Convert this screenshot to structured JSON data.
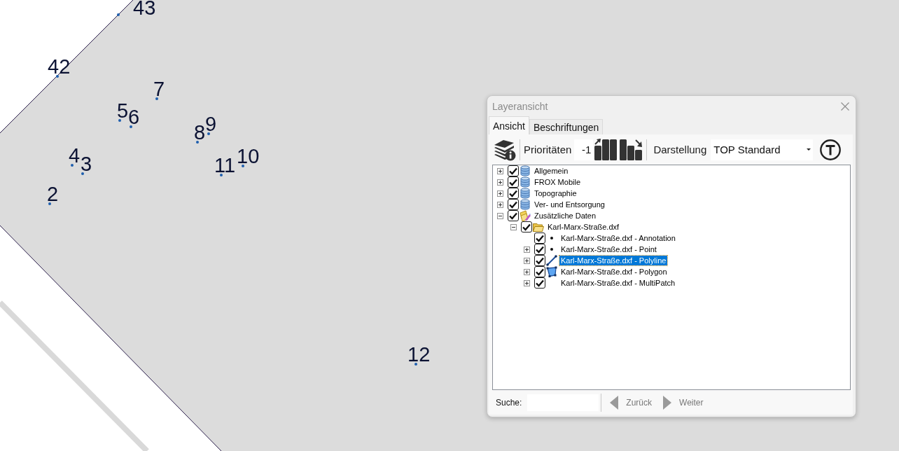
{
  "map": {
    "points": [
      {
        "label": "43"
      },
      {
        "label": "42"
      },
      {
        "label": "7"
      },
      {
        "label": "5"
      },
      {
        "label": "6"
      },
      {
        "label": "9"
      },
      {
        "label": "8"
      },
      {
        "label": "4"
      },
      {
        "label": "10"
      },
      {
        "label": "3"
      },
      {
        "label": "11"
      },
      {
        "label": "2"
      },
      {
        "label": "12"
      }
    ]
  },
  "window": {
    "title": "Layeransicht"
  },
  "tabs": [
    {
      "label": "Ansicht",
      "selected": true
    },
    {
      "label": "Beschriftungen",
      "selected": false
    }
  ],
  "toolbar": {
    "priority_label": "Prioritäten",
    "priority_value": "-1",
    "display_label": "Darstellung",
    "display_value": "TOP Standard"
  },
  "tree": [
    {
      "label": "Allgemein",
      "kind": "database",
      "expandable": true,
      "expanded": false,
      "checked": true,
      "selected": false
    },
    {
      "label": "FROX Mobile",
      "kind": "database",
      "expandable": true,
      "expanded": false,
      "checked": true,
      "selected": false
    },
    {
      "label": "Topographie",
      "kind": "database",
      "expandable": true,
      "expanded": false,
      "checked": true,
      "selected": false
    },
    {
      "label": "Ver- und Entsorgung",
      "kind": "database",
      "expandable": true,
      "expanded": false,
      "checked": true,
      "selected": false
    },
    {
      "label": "Zusätzliche Daten",
      "kind": "custom",
      "expandable": true,
      "expanded": true,
      "checked": true,
      "selected": false,
      "children": [
        {
          "label": "Karl-Marx-Straße.dxf",
          "kind": "folder",
          "expandable": true,
          "expanded": true,
          "checked": true,
          "selected": false,
          "children": [
            {
              "label": "Karl-Marx-Straße.dxf - Annotation",
              "kind": "point",
              "expandable": false,
              "checked": true,
              "selected": false
            },
            {
              "label": "Karl-Marx-Straße.dxf - Point",
              "kind": "point",
              "expandable": true,
              "expanded": false,
              "checked": true,
              "selected": false
            },
            {
              "label": "Karl-Marx-Straße.dxf - Polyline",
              "kind": "line",
              "expandable": true,
              "expanded": false,
              "checked": true,
              "selected": true
            },
            {
              "label": "Karl-Marx-Straße.dxf - Polygon",
              "kind": "polygon",
              "expandable": true,
              "expanded": false,
              "checked": true,
              "selected": false
            },
            {
              "label": "Karl-Marx-Straße.dxf - MultiPatch",
              "kind": "multipatch",
              "expandable": true,
              "expanded": false,
              "checked": true,
              "selected": false
            }
          ]
        }
      ]
    }
  ],
  "search": {
    "label": "Suche:"
  },
  "navigation": [
    {
      "label": "Zurück",
      "kind": "back",
      "disabled": true
    },
    {
      "label": "Weiter",
      "kind": "forward",
      "disabled": true
    }
  ]
}
